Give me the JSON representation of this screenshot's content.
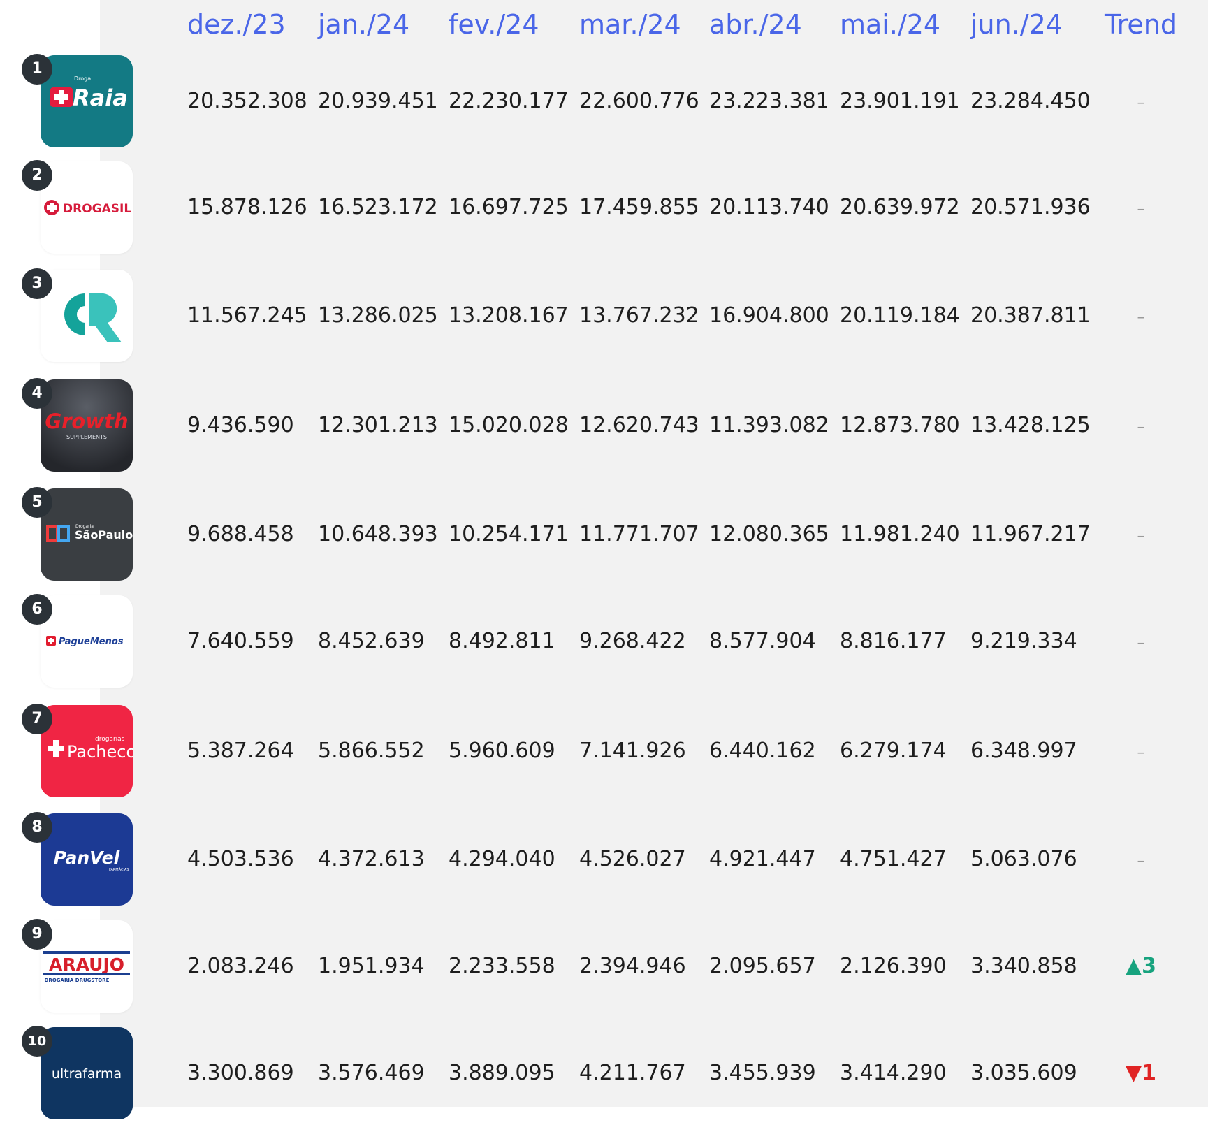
{
  "chart_data": {
    "type": "table",
    "columns": [
      "dez./23",
      "jan./24",
      "fev./24",
      "mar./24",
      "abr./24",
      "mai./24",
      "jun./24",
      "Trend"
    ],
    "rows": [
      {
        "rank": "1",
        "brand": "Droga Raia",
        "logo_text": "Raia",
        "logo_color": "#137a84",
        "values": [
          "20.352.308",
          "20.939.451",
          "22.230.177",
          "22.600.776",
          "23.223.381",
          "23.901.191",
          "23.284.450"
        ],
        "trend": {
          "dir": "flat",
          "symbol": "–",
          "value": ""
        }
      },
      {
        "rank": "2",
        "brand": "Drogasil",
        "logo_text": "DROGASIL",
        "logo_color": "#ffffff",
        "values": [
          "15.878.126",
          "16.523.172",
          "16.697.725",
          "17.459.855",
          "20.113.740",
          "20.639.972",
          "20.571.936"
        ],
        "trend": {
          "dir": "flat",
          "symbol": "–",
          "value": ""
        }
      },
      {
        "rank": "3",
        "brand": "CR",
        "logo_text": "",
        "logo_color": "#ffffff",
        "values": [
          "11.567.245",
          "13.286.025",
          "13.208.167",
          "13.767.232",
          "16.904.800",
          "20.119.184",
          "20.387.811"
        ],
        "trend": {
          "dir": "flat",
          "symbol": "–",
          "value": ""
        }
      },
      {
        "rank": "4",
        "brand": "Growth Supplements",
        "logo_text": "Growth",
        "logo_color": "#3a3d44",
        "values": [
          "9.436.590",
          "12.301.213",
          "15.020.028",
          "12.620.743",
          "11.393.082",
          "12.873.780",
          "13.428.125"
        ],
        "trend": {
          "dir": "flat",
          "symbol": "–",
          "value": ""
        }
      },
      {
        "rank": "5",
        "brand": "Drogaria São Paulo",
        "logo_text": "SãoPaulo",
        "logo_color": "#3a3e42",
        "values": [
          "9.688.458",
          "10.648.393",
          "10.254.171",
          "11.771.707",
          "12.080.365",
          "11.981.240",
          "11.967.217"
        ],
        "trend": {
          "dir": "flat",
          "symbol": "–",
          "value": ""
        }
      },
      {
        "rank": "6",
        "brand": "Pague Menos",
        "logo_text": "PagueMenos",
        "logo_color": "#ffffff",
        "values": [
          "7.640.559",
          "8.452.639",
          "8.492.811",
          "9.268.422",
          "8.577.904",
          "8.816.177",
          "9.219.334"
        ],
        "trend": {
          "dir": "flat",
          "symbol": "–",
          "value": ""
        }
      },
      {
        "rank": "7",
        "brand": "Drogarias Pacheco",
        "logo_text": "Pacheco",
        "logo_color": "#f02544",
        "values": [
          "5.387.264",
          "5.866.552",
          "5.960.609",
          "7.141.926",
          "6.440.162",
          "6.279.174",
          "6.348.997"
        ],
        "trend": {
          "dir": "flat",
          "symbol": "–",
          "value": ""
        }
      },
      {
        "rank": "8",
        "brand": "PanVel",
        "logo_text": "PanVel",
        "logo_color": "#1c3a94",
        "values": [
          "4.503.536",
          "4.372.613",
          "4.294.040",
          "4.526.027",
          "4.921.447",
          "4.751.427",
          "5.063.076"
        ],
        "trend": {
          "dir": "flat",
          "symbol": "–",
          "value": ""
        }
      },
      {
        "rank": "9",
        "brand": "Araujo",
        "logo_text": "ARAUJO",
        "logo_color": "#ffffff",
        "values": [
          "2.083.246",
          "1.951.934",
          "2.233.558",
          "2.394.946",
          "2.095.657",
          "2.126.390",
          "3.340.858"
        ],
        "trend": {
          "dir": "up",
          "symbol": "▲",
          "value": "3"
        }
      },
      {
        "rank": "10",
        "brand": "Ultrafarma",
        "logo_text": "ultrafarma",
        "logo_color": "#0f3561",
        "values": [
          "3.300.869",
          "3.576.469",
          "3.889.095",
          "4.211.767",
          "3.455.939",
          "3.414.290",
          "3.035.609"
        ],
        "trend": {
          "dir": "down",
          "symbol": "▼",
          "value": "1"
        }
      }
    ]
  }
}
